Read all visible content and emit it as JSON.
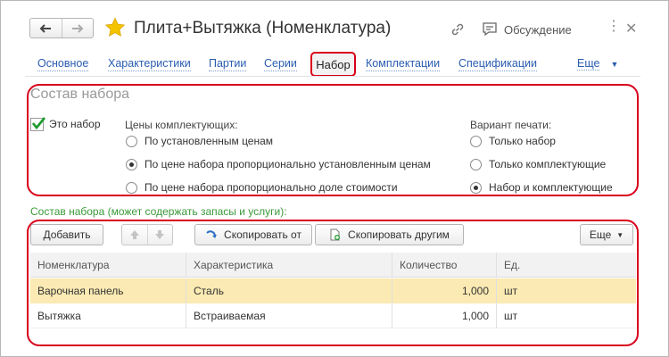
{
  "window": {
    "title": "Плита+Вытяжка (Номенклатура)",
    "discussion_label": "Обсуждение"
  },
  "icons": {
    "back": "arrow-left-icon",
    "forward": "arrow-right-icon",
    "favorite": "star-icon",
    "link": "link-icon",
    "discussion": "speech-bubble-icon",
    "menu": "more-vertical-icon",
    "close": "close-icon"
  },
  "tabs": [
    {
      "label": "Основное"
    },
    {
      "label": "Характеристики"
    },
    {
      "label": "Партии"
    },
    {
      "label": "Серии"
    },
    {
      "label": "Набор",
      "active": true
    },
    {
      "label": "Комплектации"
    },
    {
      "label": "Спецификации"
    }
  ],
  "tabs_more_label": "Еще",
  "set_section": {
    "title": "Состав набора",
    "is_set_label": "Это набор",
    "is_set_checked": true,
    "prices_group": {
      "label": "Цены комплектующих:",
      "options": [
        {
          "label": "По установленным ценам",
          "selected": false
        },
        {
          "label": "По цене набора пропорционально установленным ценам",
          "selected": true
        },
        {
          "label": "По цене набора пропорционально доле стоимости",
          "selected": false
        }
      ]
    },
    "print_group": {
      "label": "Вариант печати:",
      "options": [
        {
          "label": "Только набор",
          "selected": false
        },
        {
          "label": "Только комплектующие",
          "selected": false
        },
        {
          "label": "Набор и комплектующие",
          "selected": true
        }
      ]
    }
  },
  "composition": {
    "label": "Состав набора (может содержать запасы и услуги):",
    "toolbar": {
      "add_label": "Добавить",
      "copy_from_label": "Скопировать от",
      "copy_to_label": "Скопировать другим",
      "more_label": "Еще"
    },
    "columns": [
      "Номенклатура",
      "Характеристика",
      "Количество",
      "Ед."
    ],
    "rows": [
      {
        "item": "Варочная панель",
        "characteristic": "Сталь",
        "quantity": "1,000",
        "unit": "шт"
      },
      {
        "item": "Вытяжка",
        "characteristic": "Встраиваемая",
        "quantity": "1,000",
        "unit": "шт"
      }
    ]
  },
  "colors": {
    "highlight": "#d9001b",
    "link": "#2a5db0",
    "selected_row": "#fbeab3",
    "section_label": "#3a9a3a",
    "star": "#f5c400"
  }
}
